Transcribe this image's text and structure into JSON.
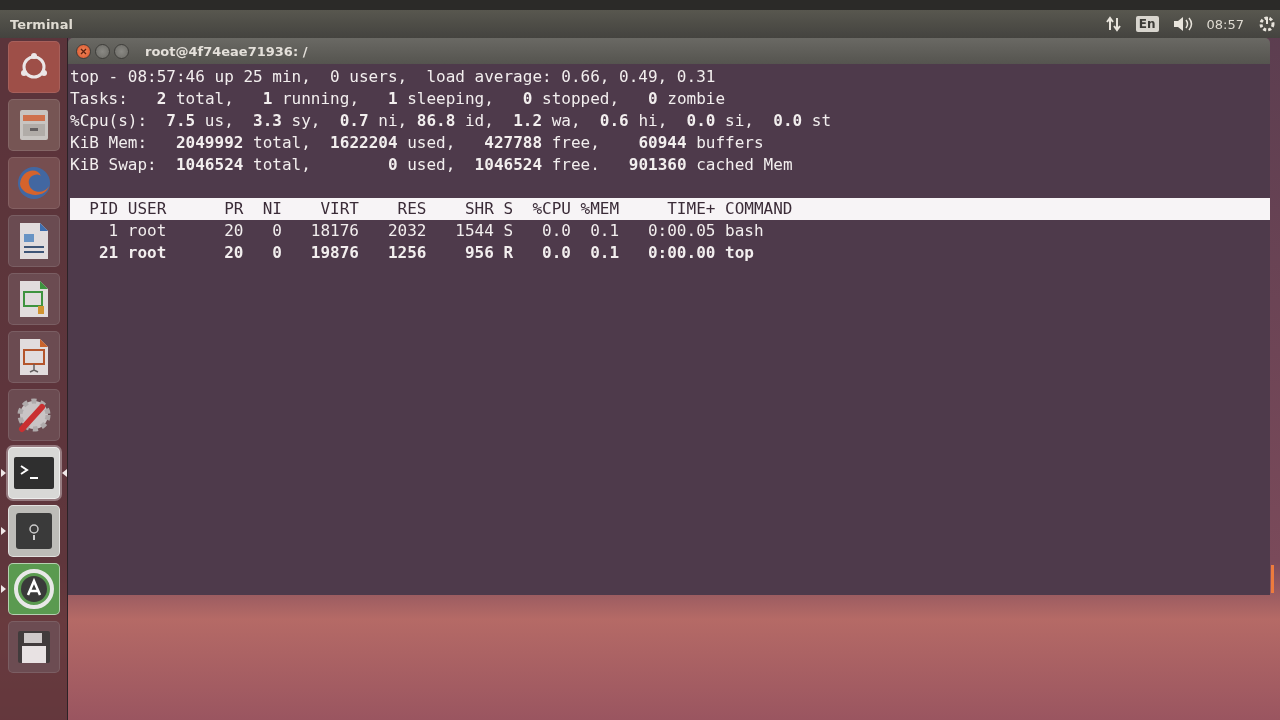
{
  "top_panel": {
    "title": "Terminal",
    "keyboard_layout": "En",
    "clock": "08:57"
  },
  "launcher": [
    {
      "kind": "dash",
      "running": false,
      "focused": false
    },
    {
      "kind": "files",
      "running": false,
      "focused": false
    },
    {
      "kind": "browser",
      "running": false,
      "focused": false
    },
    {
      "kind": "writer",
      "running": false,
      "focused": false
    },
    {
      "kind": "calc",
      "running": false,
      "focused": false
    },
    {
      "kind": "impress",
      "running": false,
      "focused": false
    },
    {
      "kind": "settings",
      "running": false,
      "focused": false
    },
    {
      "kind": "terminal",
      "running": true,
      "focused": true
    },
    {
      "kind": "safe",
      "running": true,
      "focused": false
    },
    {
      "kind": "updater",
      "running": true,
      "focused": false
    },
    {
      "kind": "disk",
      "running": false,
      "focused": false
    }
  ],
  "terminal": {
    "title": "root@4f74eae71936: /",
    "summary_lines": [
      "top - 08:57:46 up 25 min,  0 users,  load average: 0.66, 0.49, 0.31",
      "Tasks:   **2** total,   **1** running,   **1** sleeping,   **0** stopped,   **0** zombie",
      "%Cpu(s):  **7.5** us,  **3.3** sy,  **0.7** ni, **86.8** id,  **1.2** wa,  **0.6** hi,  **0.0** si,  **0.0** st",
      "KiB Mem:   **2049992** total,  **1622204** used,   **427788** free,    **60944** buffers",
      "KiB Swap:  **1046524** total,        **0** used,  **1046524** free.   **901360** cached Mem"
    ],
    "header_line": "  PID USER      PR  NI    VIRT    RES    SHR S  %CPU %MEM     TIME+ COMMAND",
    "process_rows": [
      {
        "text": "    1 root      20   0   18176   2032   1544 S   0.0  0.1   0:00.05 bash",
        "highlighted": false
      },
      {
        "text": "   21 root      20   0   19876   1256    956 R   0.0  0.1   0:00.00 top",
        "highlighted": true
      }
    ]
  }
}
